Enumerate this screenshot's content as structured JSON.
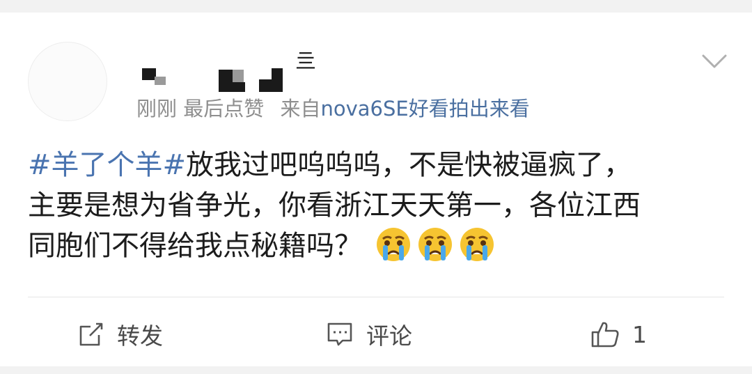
{
  "post": {
    "meta": {
      "time": "刚刚",
      "status": "最后点赞",
      "source_prefix": "来自",
      "source": "nova6SE好看拍出来看"
    },
    "name_glyph": "亖",
    "text": {
      "topic": "#羊了个羊#",
      "line1_rest": "放我过吧呜呜呜，不是快被逼疯了，",
      "line2": "主要是想为省争光，你看浙江天天第一，各位江西",
      "line3": "同胞们不得给我点秘籍吗？"
    },
    "emoji_icons": [
      "crying-face-icon",
      "crying-face-icon",
      "crying-face-icon"
    ]
  },
  "actions": {
    "repost_label": "转发",
    "comment_label": "评论",
    "like_count": "1"
  }
}
